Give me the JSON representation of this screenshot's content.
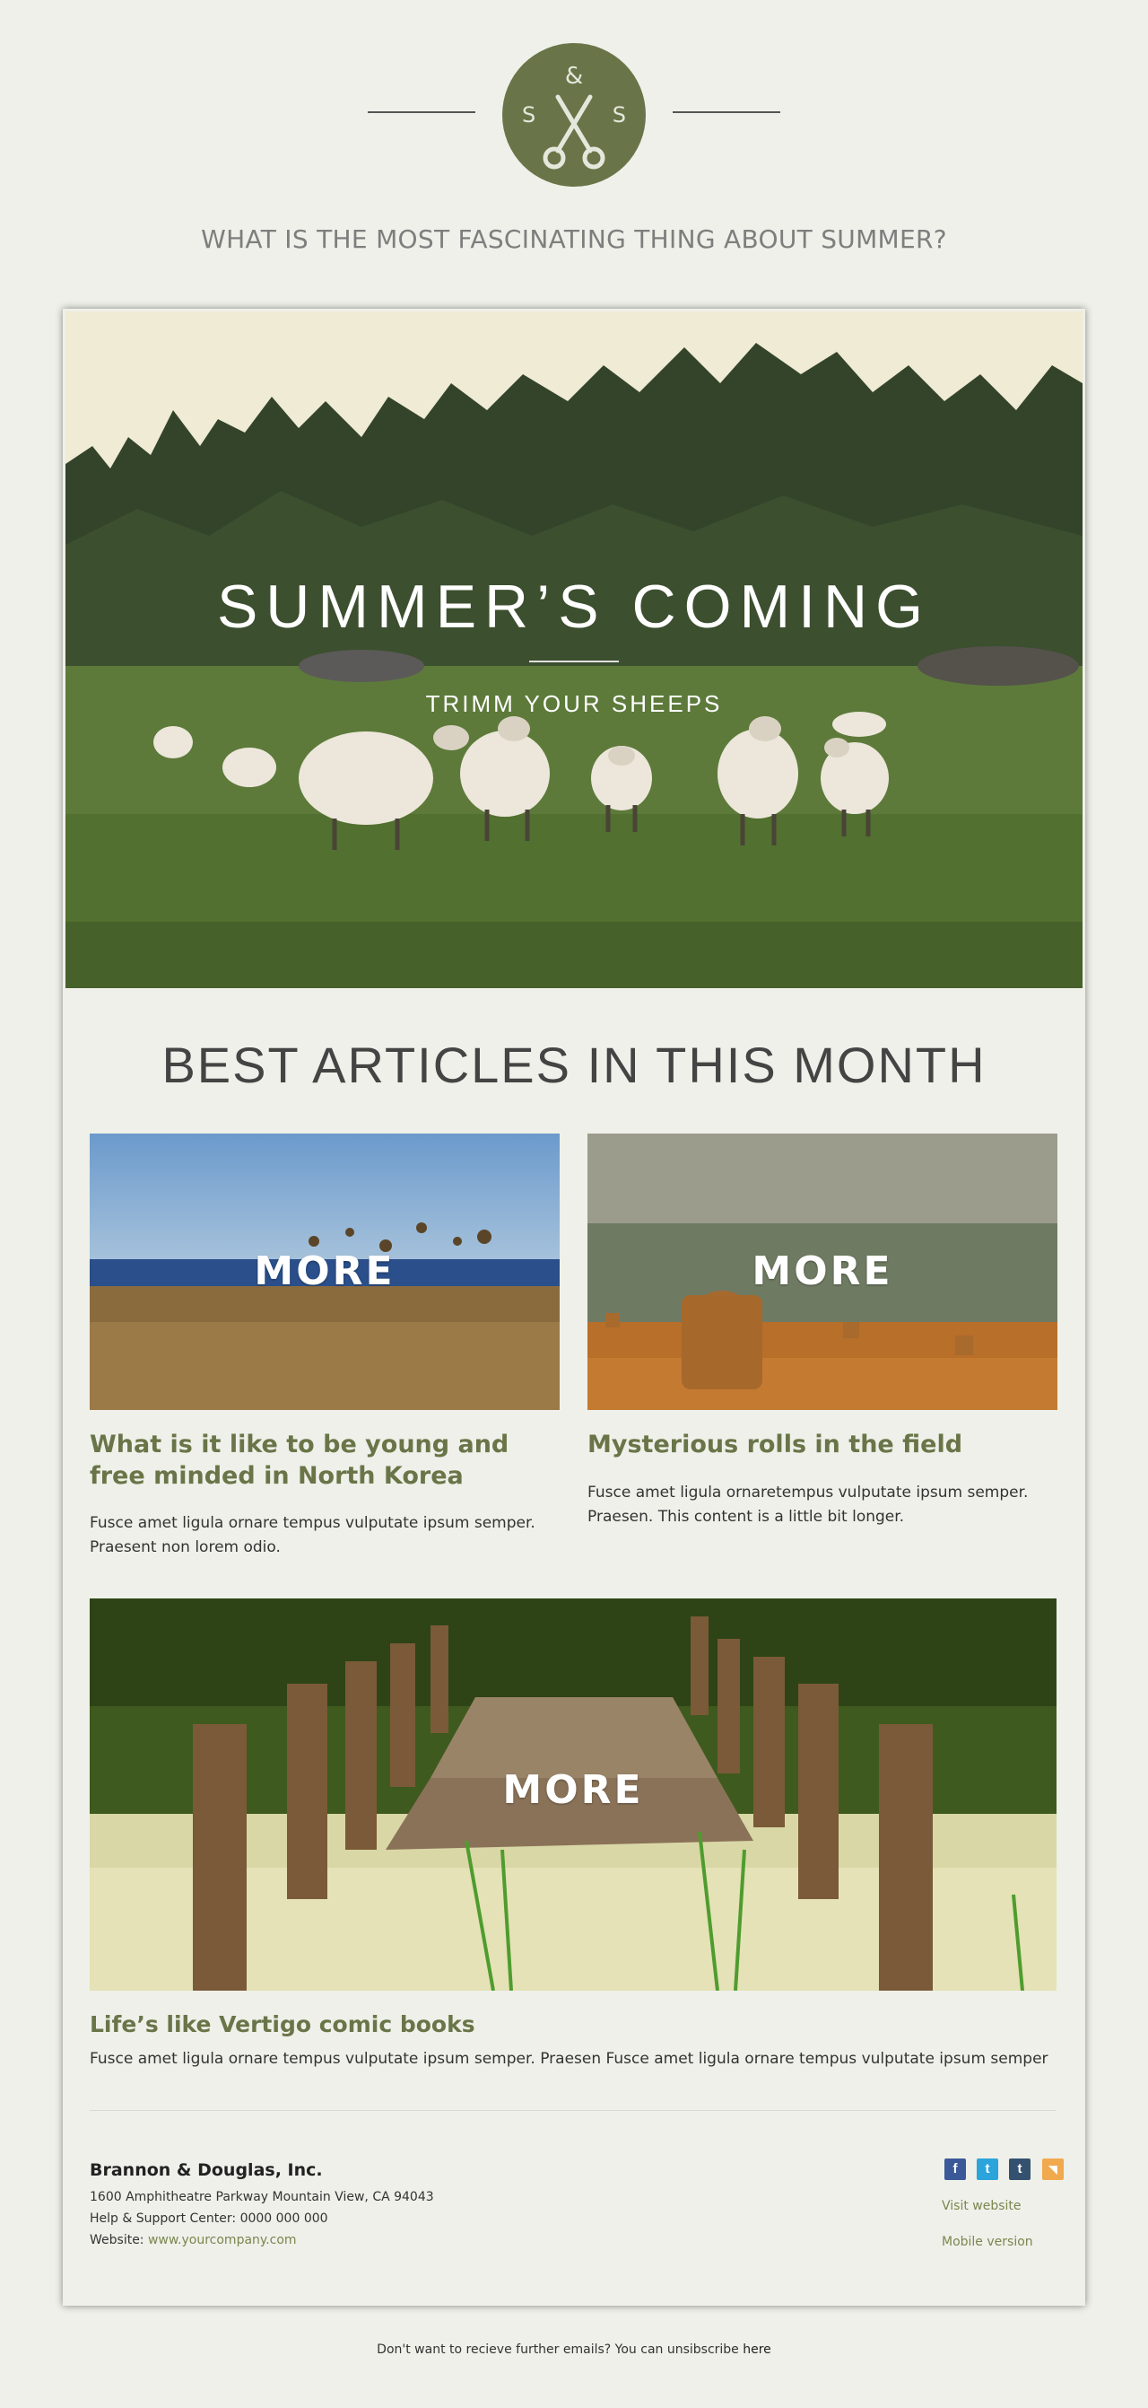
{
  "header": {
    "logo": {
      "amp": "&",
      "left_letter": "S",
      "right_letter": "S",
      "icon": "scissors-icon"
    },
    "tagline": "WHAT IS THE MOST FASCINATING THING ABOUT SUMMER?"
  },
  "hero": {
    "title": "SUMMER’S COMING",
    "subtitle": "TRIMM YOUR SHEEPS"
  },
  "section": {
    "title": "BEST ARTICLES IN THIS MONTH"
  },
  "articles": [
    {
      "more_label": "MORE",
      "title": "What is it like to be young and free minded in North Korea",
      "body": "Fusce amet ligula ornare tempus vulputate ipsum semper. Praesent non lorem odio."
    },
    {
      "more_label": "MORE",
      "title": "Mysterious rolls in the field",
      "body": "Fusce amet ligula ornaretempus vulputate ipsum semper. Praesen. This content is a little bit longer."
    },
    {
      "more_label": "MORE",
      "title": "Life’s like Vertigo comic books",
      "body": "Fusce amet ligula ornare tempus vulputate ipsum semper. Praesen Fusce amet ligula ornare tempus vulputate ipsum semper"
    }
  ],
  "company": {
    "name": "Brannon & Douglas, Inc.",
    "address": "1600 Amphitheatre Parkway Mountain View, CA 94043",
    "support": "Help & Support Center: 0000 000 000",
    "website_label": "Website: ",
    "website_link": "www.yourcompany.com"
  },
  "social": [
    {
      "icon": "facebook-icon",
      "glyph": "f",
      "color": "#3b5998"
    },
    {
      "icon": "twitter-icon",
      "glyph": "t",
      "color": "#2ba4dc"
    },
    {
      "icon": "tumblr-icon",
      "glyph": "t",
      "color": "#34526f"
    },
    {
      "icon": "rss-icon",
      "glyph": "◥",
      "color": "#f1a94e"
    }
  ],
  "links": {
    "visit": "Visit website",
    "mobile": "Mobile version"
  },
  "footer": {
    "text": "Don't want to recieve further emails? You can unsibscribe ",
    "link": "here"
  },
  "colors": {
    "accent": "#697548",
    "background": "#eff0e9"
  }
}
